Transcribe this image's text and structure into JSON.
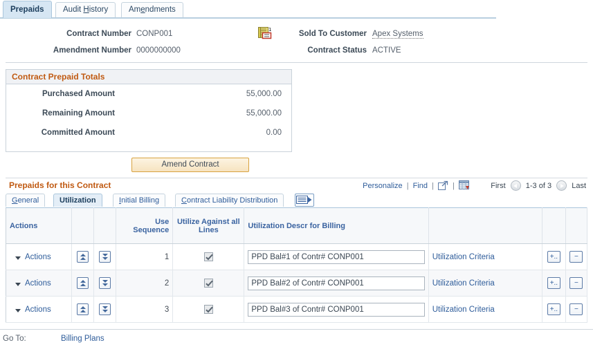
{
  "top_tabs": [
    {
      "label": "Prepaids",
      "active": true,
      "accel": ""
    },
    {
      "label": "Audit History",
      "active": false,
      "accel": "H"
    },
    {
      "label": "Amendments",
      "active": false,
      "accel": "e"
    }
  ],
  "header": {
    "contract_number_label": "Contract Number",
    "contract_number_value": "CONP001",
    "amendment_number_label": "Amendment Number",
    "amendment_number_value": "0000000000",
    "sold_to_customer_label": "Sold To Customer",
    "sold_to_customer_value": "Apex Systems",
    "contract_status_label": "Contract Status",
    "contract_status_value": "ACTIVE",
    "doc_icon": "contract-notes-icon"
  },
  "totals": {
    "title": "Contract Prepaid Totals",
    "rows": [
      {
        "label": "Purchased Amount",
        "value": "55,000.00"
      },
      {
        "label": "Remaining Amount",
        "value": "55,000.00"
      },
      {
        "label": "Committed Amount",
        "value": "0.00"
      }
    ]
  },
  "amend_button": "Amend Contract",
  "grid": {
    "title": "Prepaids for this Contract",
    "tools": {
      "personalize": "Personalize",
      "find": "Find",
      "separator": "|",
      "new_window_icon": "new-window-icon",
      "download_icon": "download-to-excel-icon"
    },
    "nav": {
      "first": "First",
      "prev_icon": "previous-page-icon",
      "range": "1-3 of 3",
      "next_icon": "next-page-icon",
      "last": "Last"
    },
    "inner_tabs": [
      {
        "label": "General",
        "active": false,
        "accel": "G"
      },
      {
        "label": "Utilization",
        "active": true,
        "accel": ""
      },
      {
        "label": "Initial Billing",
        "active": false,
        "accel": "I"
      },
      {
        "label": "Contract Liability Distribution",
        "active": false,
        "accel": "C"
      },
      {
        "label": "",
        "active": false,
        "accel": "",
        "icon": "show-all-columns-icon"
      }
    ],
    "columns": [
      "Actions",
      "",
      "",
      "Use Sequence",
      "Utilize Against all Lines",
      "Utilization Descr for Billing",
      "",
      "",
      ""
    ],
    "rows": [
      {
        "actions_label": "Actions",
        "move_up_icon": "move-to-top-icon",
        "move_down_icon": "move-to-bottom-icon",
        "use_sequence": "1",
        "utilize_all_lines": true,
        "utilization_descr": "PPD Bal#1 of Contr# CONP001",
        "criteria_link": "Utilization Criteria",
        "add_label": "+..",
        "delete_label": "−"
      },
      {
        "actions_label": "Actions",
        "move_up_icon": "move-to-top-icon",
        "move_down_icon": "move-to-bottom-icon",
        "use_sequence": "2",
        "utilize_all_lines": true,
        "utilization_descr": "PPD Bal#2 of Contr# CONP001",
        "criteria_link": "Utilization Criteria",
        "add_label": "+..",
        "delete_label": "−"
      },
      {
        "actions_label": "Actions",
        "move_up_icon": "move-to-top-icon",
        "move_down_icon": "move-to-bottom-icon",
        "use_sequence": "3",
        "utilize_all_lines": true,
        "utilization_descr": "PPD Bal#3 of Contr# CONP001",
        "criteria_link": "Utilization Criteria",
        "add_label": "+..",
        "delete_label": "−"
      }
    ]
  },
  "footer": {
    "goto_label": "Go To:",
    "goto_link": "Billing Plans"
  },
  "colors": {
    "section_heading": "#c05a12",
    "link": "#2e5c9a",
    "active_tab_bg": "#d6e6f3",
    "button_border": "#d8a23f"
  }
}
